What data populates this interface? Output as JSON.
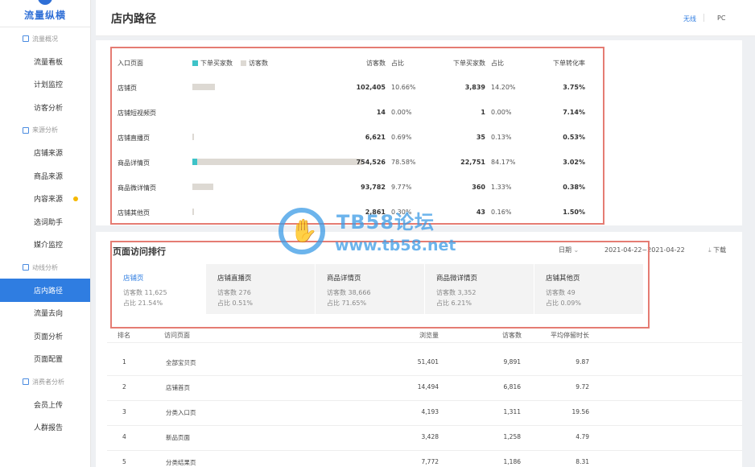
{
  "sidebar": {
    "brand": "流量纵横",
    "groups": [
      {
        "title": "流量概况",
        "items": [
          {
            "label": "流量看板"
          },
          {
            "label": "计划监控"
          },
          {
            "label": "访客分析"
          }
        ]
      },
      {
        "title": "来源分析",
        "items": [
          {
            "label": "店铺来源"
          },
          {
            "label": "商品来源"
          },
          {
            "label": "内容来源"
          },
          {
            "label": "选词助手"
          },
          {
            "label": "媒介监控"
          }
        ]
      },
      {
        "title": "动线分析",
        "items": [
          {
            "label": "店内路径"
          },
          {
            "label": "流量去向"
          },
          {
            "label": "页面分析"
          },
          {
            "label": "页面配置"
          }
        ]
      },
      {
        "title": "消费者分析",
        "items": [
          {
            "label": "会员上传"
          },
          {
            "label": "人群报告"
          }
        ]
      }
    ],
    "active_item": "店内路径",
    "dot_color": "#f5b800"
  },
  "header": {
    "title": "店内路径",
    "tab_wireless": "无线",
    "tab_pc": "PC"
  },
  "path_table": {
    "headers": {
      "entry": "入口页面",
      "legend_buy": "下单买家数",
      "legend_visitor": "访客数",
      "visitors": "访客数",
      "share": "占比",
      "buyers": "下单买家数",
      "buyer_share": "占比",
      "conversion": "下单转化率"
    },
    "rows": [
      {
        "name": "店铺页",
        "visitors": "102,405",
        "share": "10.66%",
        "buyers": "3,839",
        "buyer_share": "14.20%",
        "conversion": "3.75%",
        "vis_frac": 0.1066,
        "buy_frac": 0.0
      },
      {
        "name": "店铺短视频页",
        "visitors": "14",
        "share": "0.00%",
        "buyers": "1",
        "buyer_share": "0.00%",
        "conversion": "7.14%",
        "vis_frac": 0.0,
        "buy_frac": 0.0
      },
      {
        "name": "店铺直播页",
        "visitors": "6,621",
        "share": "0.69%",
        "buyers": "35",
        "buyer_share": "0.13%",
        "conversion": "0.53%",
        "vis_frac": 0.0069,
        "buy_frac": 0.0
      },
      {
        "name": "商品详情页",
        "visitors": "754,526",
        "share": "78.58%",
        "buyers": "22,751",
        "buyer_share": "84.17%",
        "conversion": "3.02%",
        "vis_frac": 0.7858,
        "buy_frac": 0.0237
      },
      {
        "name": "商品微详情页",
        "visitors": "93,782",
        "share": "9.77%",
        "buyers": "360",
        "buyer_share": "1.33%",
        "conversion": "0.38%",
        "vis_frac": 0.0977,
        "buy_frac": 0.0
      },
      {
        "name": "店铺其他页",
        "visitors": "2,861",
        "share": "0.30%",
        "buyers": "43",
        "buyer_share": "0.16%",
        "conversion": "1.50%",
        "vis_frac": 0.003,
        "buy_frac": 0.0
      }
    ],
    "buy_color": "#3ec3c8",
    "visitor_color": "#ddd9d3"
  },
  "ranking": {
    "title": "页面访问排行",
    "date_label": "日期",
    "date_range": "2021-04-22~2021-04-22",
    "download": "下载",
    "visitor_prefix": "访客数",
    "share_prefix": "占比",
    "cards": [
      {
        "name": "店铺页",
        "visitors": "11,625",
        "share": "21.54%"
      },
      {
        "name": "店铺直播页",
        "visitors": "276",
        "share": "0.51%"
      },
      {
        "name": "商品详情页",
        "visitors": "38,666",
        "share": "71.65%"
      },
      {
        "name": "商品微详情页",
        "visitors": "3,352",
        "share": "6.21%"
      },
      {
        "name": "店铺其他页",
        "visitors": "49",
        "share": "0.09%"
      }
    ],
    "table_headers": {
      "rank": "排名",
      "page": "访问页面",
      "pv": "浏览量",
      "uv": "访客数",
      "stay": "平均停留时长"
    },
    "rows": [
      {
        "rank": "1",
        "page": "全部宝贝页",
        "pv": "51,401",
        "uv": "9,891",
        "stay": "9.87"
      },
      {
        "rank": "2",
        "page": "店铺首页",
        "pv": "14,494",
        "uv": "6,816",
        "stay": "9.72"
      },
      {
        "rank": "3",
        "page": "分类入口页",
        "pv": "4,193",
        "uv": "1,311",
        "stay": "19.56"
      },
      {
        "rank": "4",
        "page": "新品页面",
        "pv": "3,428",
        "uv": "1,258",
        "stay": "4.79"
      },
      {
        "rank": "5",
        "page": "分类结果页",
        "pv": "7,772",
        "uv": "1,186",
        "stay": "8.31"
      }
    ]
  },
  "watermark": {
    "top": "TB58论坛",
    "bottom": "www.tb58.net"
  },
  "colors": {
    "accent": "#2f7de1",
    "highlight_border": "#e57c73"
  }
}
